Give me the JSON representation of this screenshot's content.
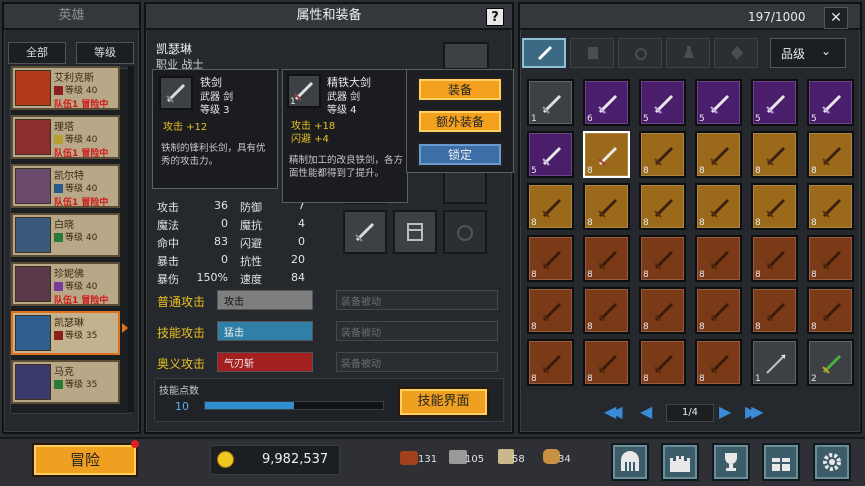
{
  "left_panel": {
    "title": "英雄",
    "tabs": [
      "全部",
      "等级"
    ],
    "heroes": [
      {
        "name": "艾利克斯",
        "line": "等级 40",
        "tag": "队伍1 冒险中",
        "color": "#b03a1a"
      },
      {
        "name": "理塔",
        "line": "等级 40",
        "tag": "队伍1 冒险中",
        "color": "#8c2e2e"
      },
      {
        "name": "凯尔特",
        "line": "等级 40",
        "tag": "队伍1 冒险中",
        "color": "#6a4a6c"
      },
      {
        "name": "白晓",
        "line": "等级 40",
        "tag": "",
        "color": "#3a5a7c"
      },
      {
        "name": "珍妮佛",
        "line": "等级 40",
        "tag": "队伍1 冒险中",
        "color": "#5a3a4a"
      },
      {
        "name": "凯瑟琳",
        "line": "等级 35",
        "tag": "",
        "color": "#2f5f8f"
      },
      {
        "name": "马克",
        "line": "等级 35",
        "tag": "",
        "color": "#3a3a6c"
      }
    ]
  },
  "center_panel": {
    "title": "属性和装备",
    "help": "?",
    "hero_name": "凯瑟琳",
    "job": "职业 战士",
    "stats": [
      [
        "攻击",
        "36",
        "防御",
        "7"
      ],
      [
        "魔法",
        "0",
        "魔抗",
        "4"
      ],
      [
        "命中",
        "83",
        "闪避",
        "0"
      ],
      [
        "暴击",
        "0",
        "抗性",
        "20"
      ],
      [
        "暴伤",
        "150%",
        "速度",
        "84"
      ]
    ],
    "skills": [
      {
        "label": "普通攻击",
        "value": "攻击",
        "passive": "装备被动"
      },
      {
        "label": "技能攻击",
        "value": "猛击",
        "passive": "装备被动"
      },
      {
        "label": "奥义攻击",
        "value": "气刃斩",
        "passive": "装备被动"
      }
    ],
    "skill_points_label": "技能点数",
    "skill_points": "10",
    "skill_screen_button": "技能界面"
  },
  "tooltip_current": {
    "name": "铁剑",
    "type": "武器 剑",
    "level": "等级 3",
    "attack": "攻击 +12",
    "desc": "铁制的锋利长剑，具有优秀的攻击力。"
  },
  "tooltip_new": {
    "name": "精铁大剑",
    "type": "武器 剑",
    "level": "等级 4",
    "attack": "攻击 +18",
    "dodge": "闪避 +4",
    "desc": "精制加工的改良铁剑，各方面性能都得到了提升。"
  },
  "action_menu": {
    "equip": "装备",
    "extra_equip": "额外装备",
    "lock": "锁定"
  },
  "inventory": {
    "count": "197/1000",
    "close": "✕",
    "sort_label": "品级",
    "page": "1/4",
    "grid": [
      [
        [
          "white",
          "1"
        ],
        [
          "purple",
          "6"
        ],
        [
          "purple",
          "5"
        ],
        [
          "purple",
          "5"
        ],
        [
          "purple",
          "5"
        ],
        [
          "purple",
          "5"
        ]
      ],
      [
        [
          "purple",
          "5"
        ],
        [
          "orangeSel",
          "8"
        ],
        [
          "gold",
          "8"
        ],
        [
          "gold",
          "8"
        ],
        [
          "gold",
          "8"
        ],
        [
          "gold",
          "8"
        ]
      ],
      [
        [
          "gold",
          "8"
        ],
        [
          "gold",
          "8"
        ],
        [
          "gold",
          "8"
        ],
        [
          "gold",
          "8"
        ],
        [
          "gold",
          "8"
        ],
        [
          "gold",
          "8"
        ]
      ],
      [
        [
          "brown",
          "8"
        ],
        [
          "brown",
          "8"
        ],
        [
          "brown",
          "8"
        ],
        [
          "brown",
          "8"
        ],
        [
          "brown",
          "8"
        ],
        [
          "brown",
          "8"
        ]
      ],
      [
        [
          "brown",
          "8"
        ],
        [
          "brown",
          "8"
        ],
        [
          "brown",
          "8"
        ],
        [
          "brown",
          "8"
        ],
        [
          "brown",
          "8"
        ],
        [
          "brown",
          "8"
        ]
      ],
      [
        [
          "brown",
          "8"
        ],
        [
          "brown",
          "8"
        ],
        [
          "brown",
          "8"
        ],
        [
          "brown",
          "8"
        ],
        [
          "dark",
          "1"
        ],
        [
          "dark",
          "2"
        ]
      ]
    ]
  },
  "bottom_bar": {
    "adventure_button": "冒险",
    "gold": "9,982,537",
    "resources": [
      "131",
      "105",
      "58",
      "34"
    ]
  }
}
